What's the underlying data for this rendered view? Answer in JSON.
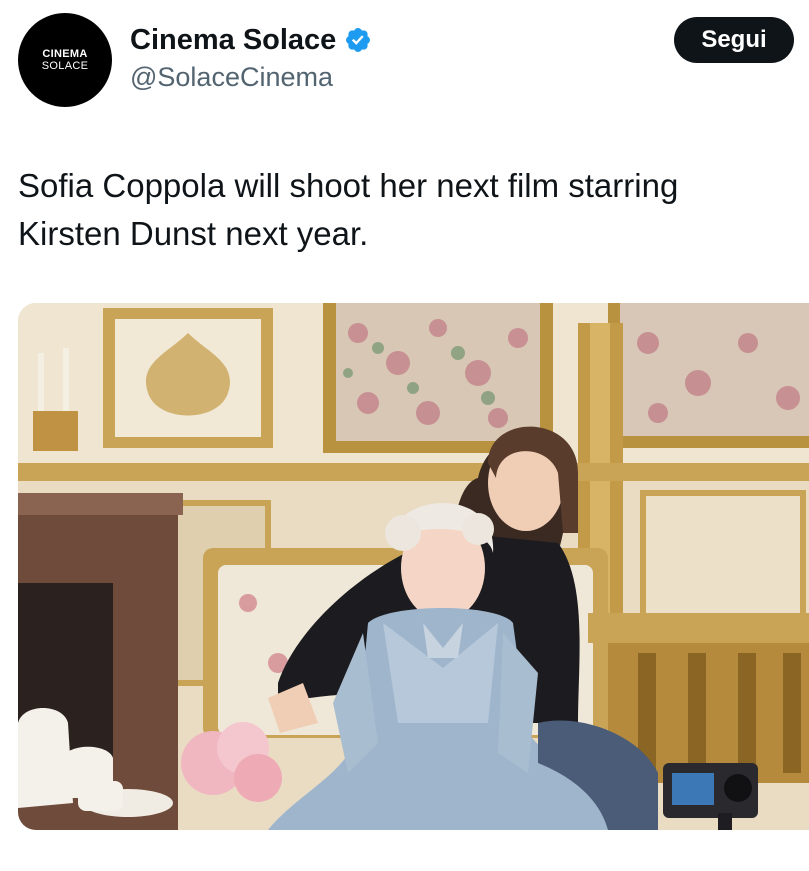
{
  "account": {
    "avatar": {
      "line1": "CINEMA",
      "line2": "SOLACE"
    },
    "display_name": "Cinema Solace",
    "handle": "@SolaceCinema",
    "verified_icon": "verified-badge-icon",
    "follow_label": "Segui"
  },
  "tweet": {
    "text": "Sofia Coppola will shoot her next film starring Kirsten Dunst next year."
  },
  "media": {
    "type": "photo",
    "icon": "photo-icon"
  },
  "colors": {
    "primary_text": "#0f1419",
    "secondary_text": "#536471",
    "verified_blue": "#1d9bf0",
    "button_bg": "#0f1419"
  }
}
